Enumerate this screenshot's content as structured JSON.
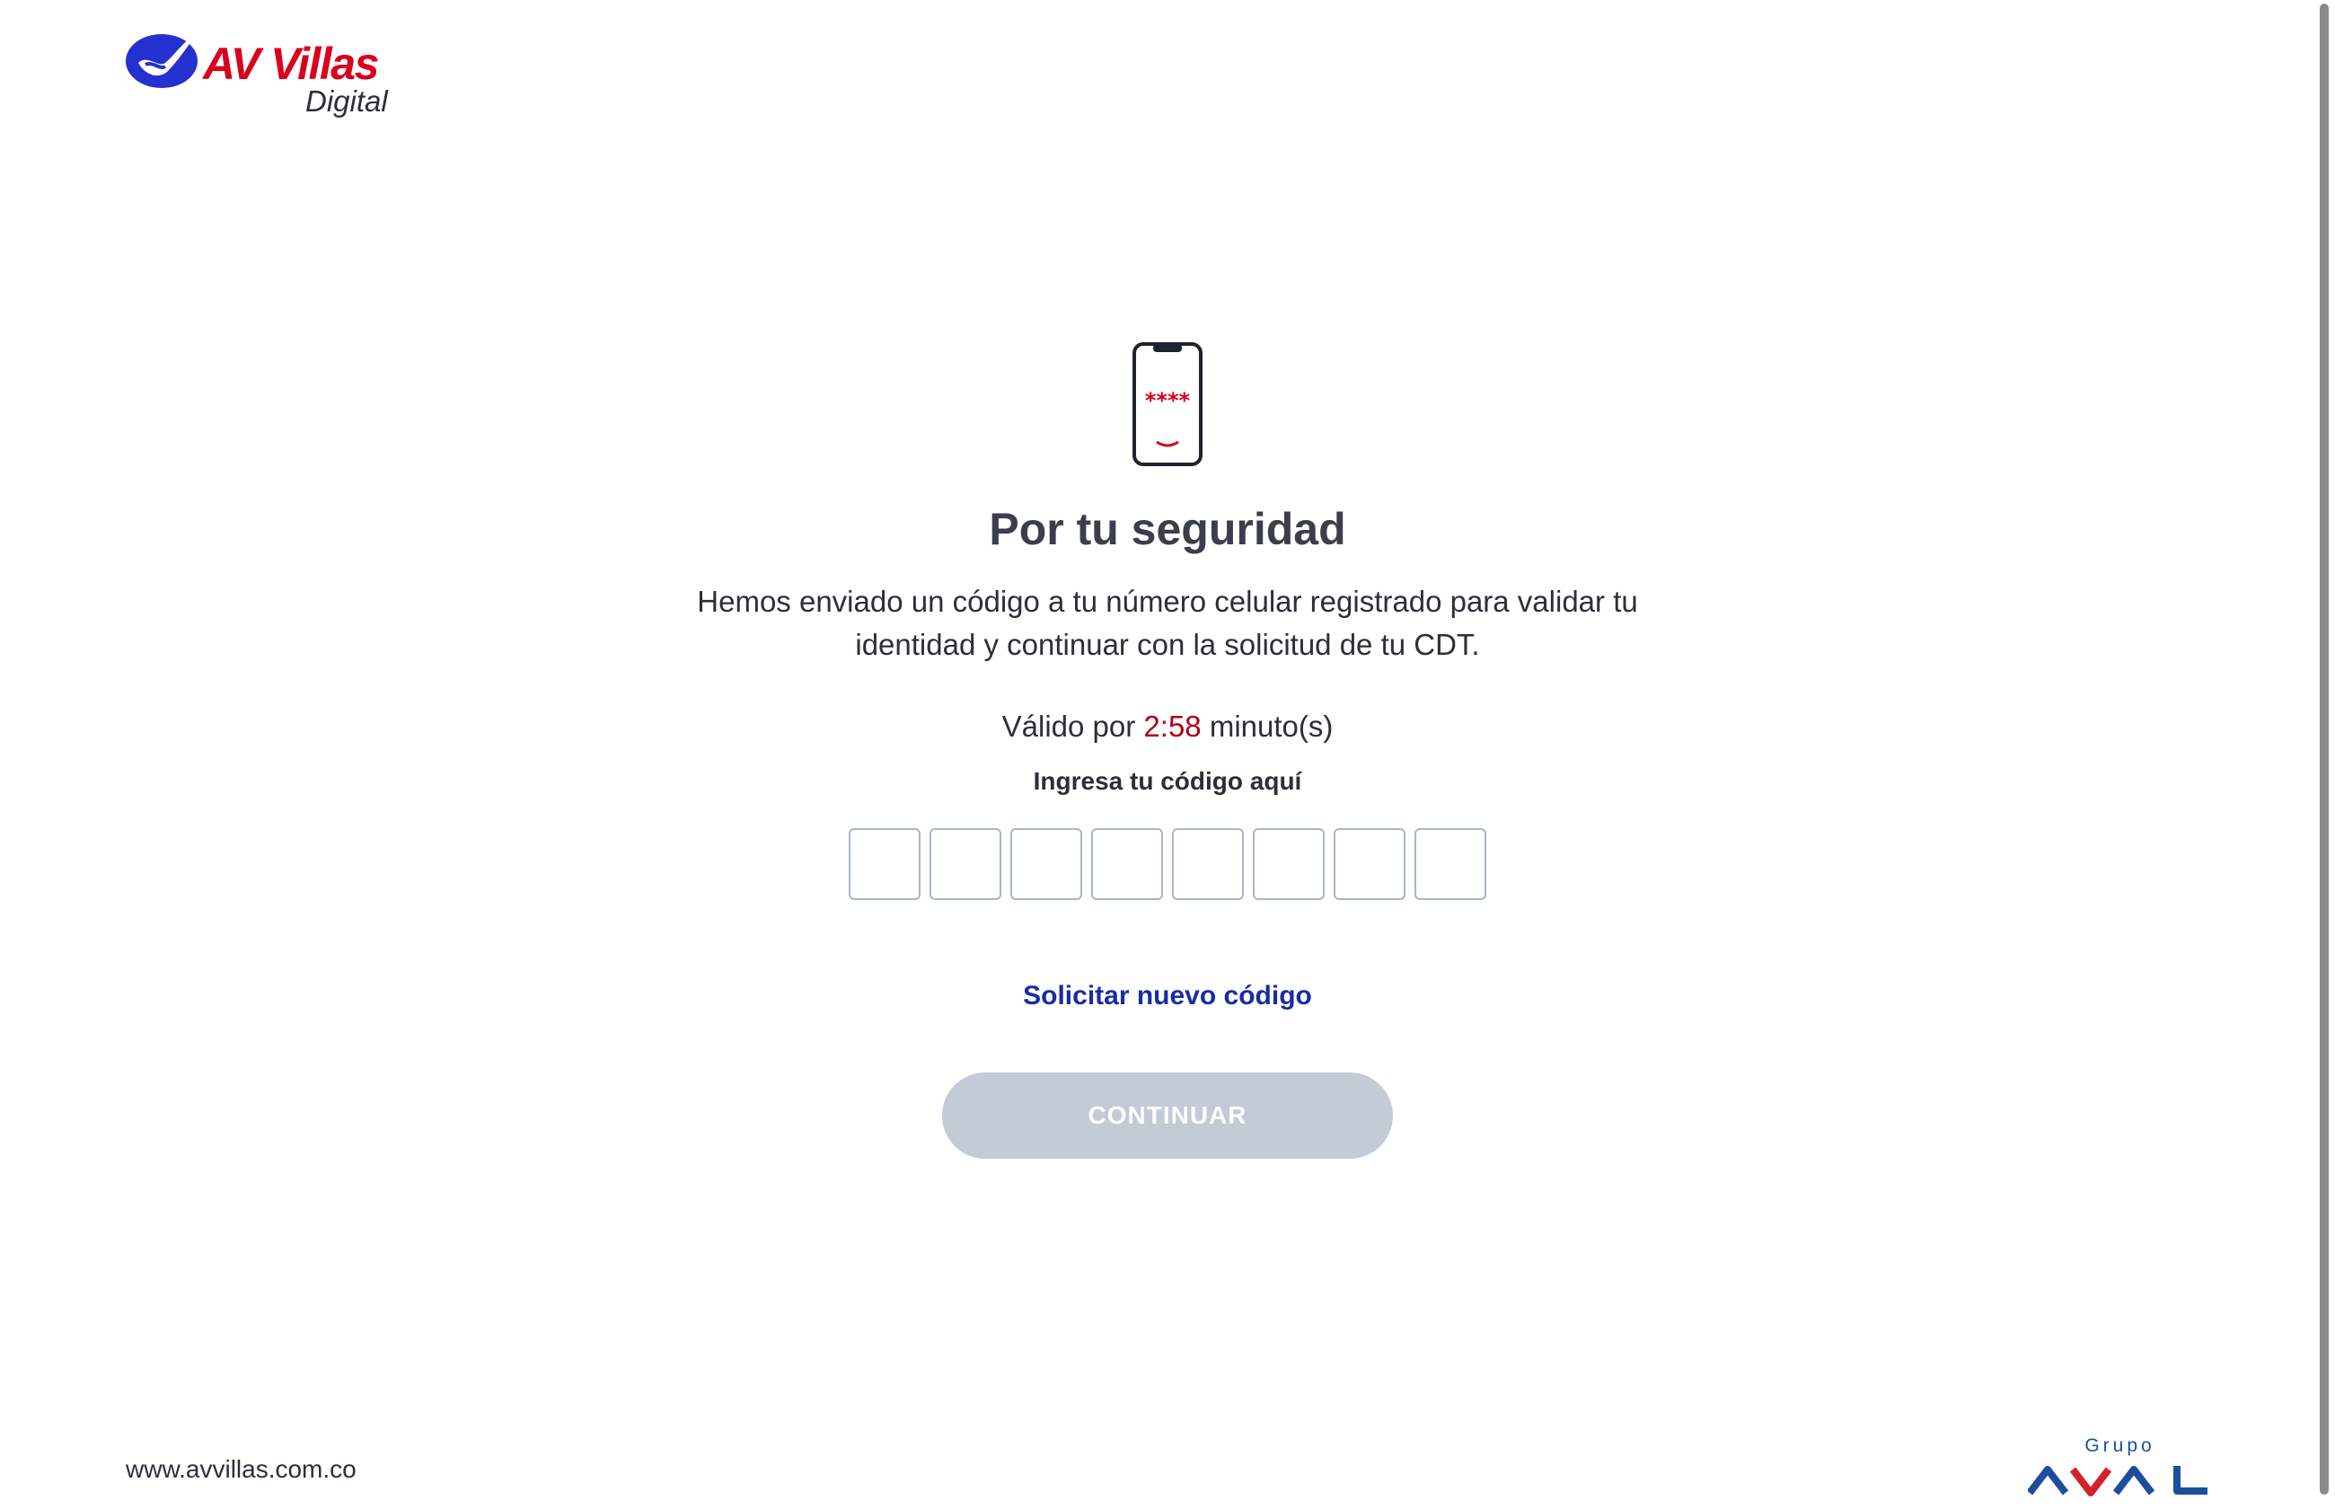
{
  "brand": {
    "name": "AV Villas",
    "subtitle": "Digital"
  },
  "main": {
    "title": "Por tu seguridad",
    "description": "Hemos enviado un código a tu número celular registrado para validar tu identidad y continuar con la solicitud de tu CDT.",
    "validity_prefix": "Válido por",
    "timer": "2:58",
    "validity_suffix": "minuto(s)",
    "code_label": "Ingresa tu código aquí",
    "code_length": 8,
    "resend_link": "Solicitar nuevo código",
    "continue_button": "CONTINUAR",
    "phone_masked_code": "****"
  },
  "footer": {
    "url": "www.avvillas.com.co",
    "group_logo_top": "Grupo",
    "group_logo_name": "AVAL"
  },
  "colors": {
    "brand_red": "#d8001c",
    "brand_blue": "#2530d0",
    "timer_red": "#b0001a",
    "link_blue": "#1a2aa8",
    "button_disabled": "#c2cbd6",
    "input_border": "#a9b4cc",
    "aval_blue": "#1b4f9c",
    "aval_red": "#d6202a"
  }
}
